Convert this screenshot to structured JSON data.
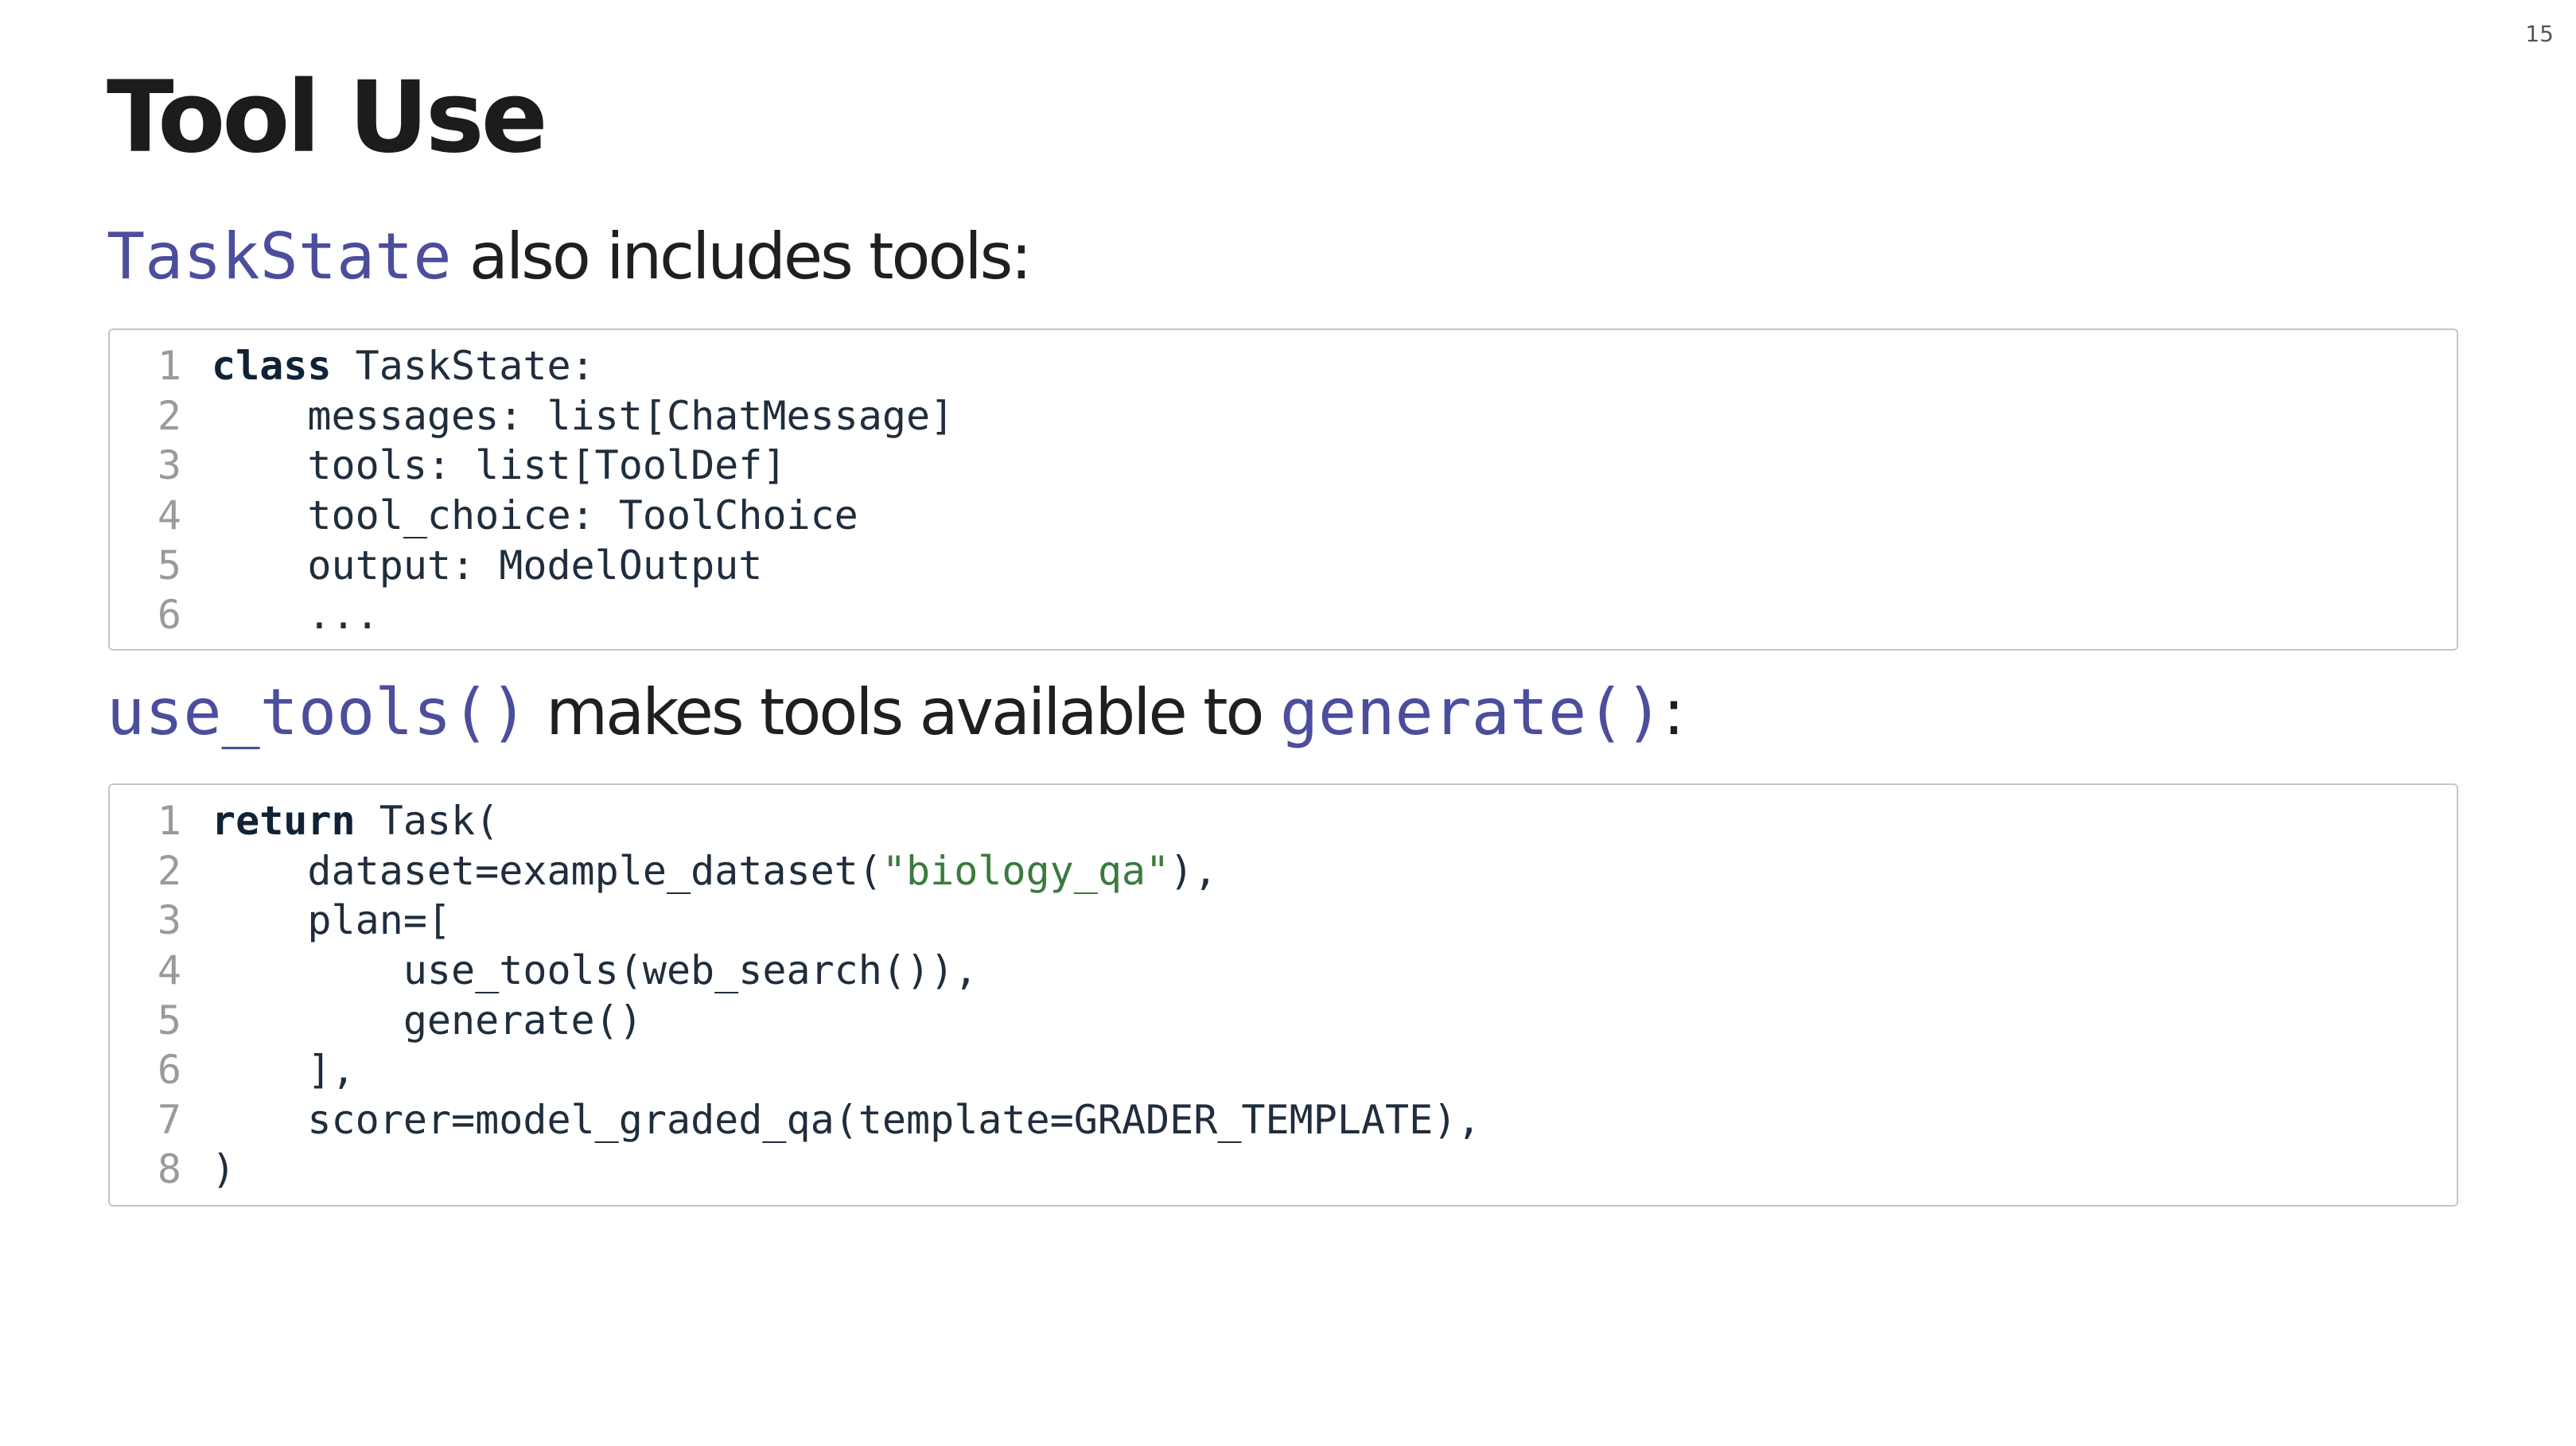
{
  "slide_number": "15",
  "title": "Tool Use",
  "section1": {
    "term": "TaskState",
    "text": " also includes tools:"
  },
  "code1": [
    {
      "n": "1",
      "indent": "",
      "kw": "class",
      "rest": " TaskState:",
      "str": "",
      "tail": ""
    },
    {
      "n": "2",
      "indent": "    ",
      "kw": "",
      "rest": "messages: list[ChatMessage]",
      "str": "",
      "tail": ""
    },
    {
      "n": "3",
      "indent": "    ",
      "kw": "",
      "rest": "tools: list[ToolDef]",
      "str": "",
      "tail": ""
    },
    {
      "n": "4",
      "indent": "    ",
      "kw": "",
      "rest": "tool_choice: ToolChoice",
      "str": "",
      "tail": ""
    },
    {
      "n": "5",
      "indent": "    ",
      "kw": "",
      "rest": "output: ModelOutput",
      "str": "",
      "tail": ""
    },
    {
      "n": "6",
      "indent": "    ",
      "kw": "",
      "rest": "...",
      "str": "",
      "tail": ""
    }
  ],
  "section2": {
    "term1": "use_tools()",
    "text1": " makes tools available to ",
    "term2": "generate()",
    "text2": ":"
  },
  "code2": [
    {
      "n": "1",
      "indent": "",
      "kw": "return",
      "rest": " Task(",
      "str": "",
      "tail": ""
    },
    {
      "n": "2",
      "indent": "    ",
      "kw": "",
      "rest": "dataset=example_dataset(",
      "str": "\"biology_qa\"",
      "tail": "),"
    },
    {
      "n": "3",
      "indent": "    ",
      "kw": "",
      "rest": "plan=[",
      "str": "",
      "tail": ""
    },
    {
      "n": "4",
      "indent": "        ",
      "kw": "",
      "rest": "use_tools(web_search()),",
      "str": "",
      "tail": ""
    },
    {
      "n": "5",
      "indent": "        ",
      "kw": "",
      "rest": "generate()",
      "str": "",
      "tail": ""
    },
    {
      "n": "6",
      "indent": "    ",
      "kw": "",
      "rest": "],",
      "str": "",
      "tail": ""
    },
    {
      "n": "7",
      "indent": "    ",
      "kw": "",
      "rest": "scorer=model_graded_qa(template=GRADER_TEMPLATE),",
      "str": "",
      "tail": ""
    },
    {
      "n": "8",
      "indent": "",
      "kw": "",
      "rest": ")",
      "str": "",
      "tail": ""
    }
  ]
}
